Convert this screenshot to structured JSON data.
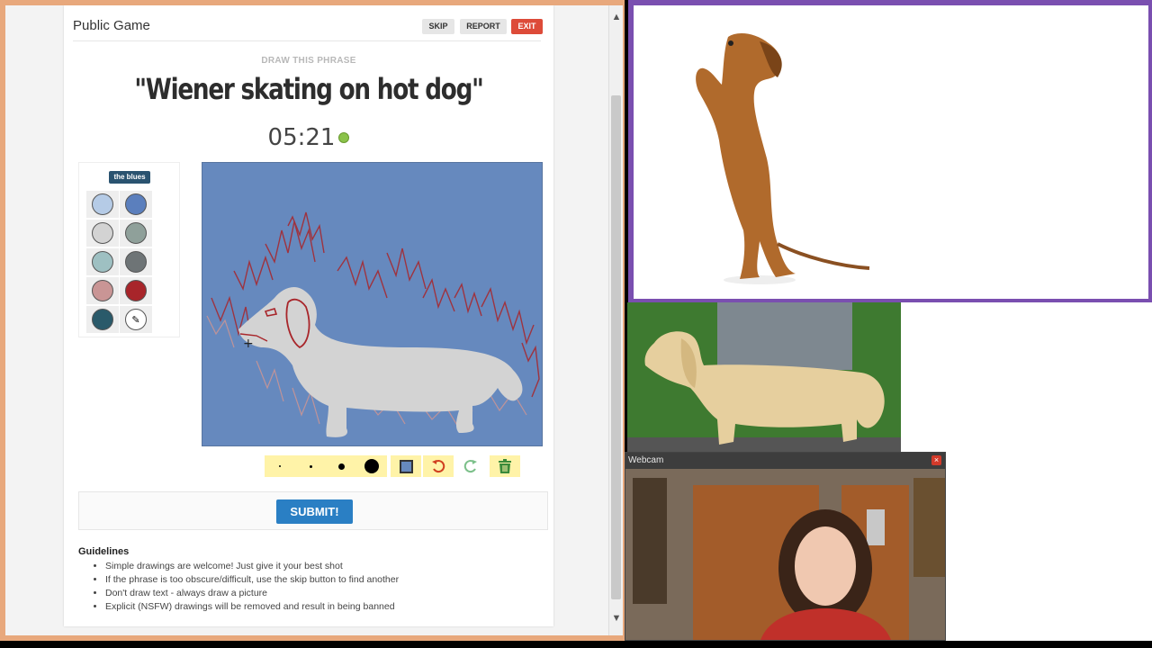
{
  "game": {
    "title": "Public Game",
    "buttons": {
      "skip": "SKIP",
      "report": "REPORT",
      "exit": "EXIT"
    },
    "instruction": "DRAW THIS PHRASE",
    "phrase": "\"Wiener skating on hot dog\"",
    "timer": "05:21"
  },
  "palette": {
    "name": "the blues",
    "colors": [
      "#b5cbe6",
      "#5b7fbd",
      "#d3d3d3",
      "#8fa09a",
      "#9ec0c2",
      "#6e7476",
      "#c99595",
      "#a8252a",
      "#2a5a6a",
      "#ffffff"
    ]
  },
  "canvas": {
    "background": "#6689be"
  },
  "toolbar": {
    "tools": [
      "brush-size-xs",
      "brush-size-s",
      "brush-size-m",
      "brush-size-l",
      "fill-tool",
      "undo",
      "redo",
      "trash"
    ]
  },
  "submit": {
    "label": "SUBMIT!"
  },
  "guidelines": {
    "title": "Guidelines",
    "items": [
      "Simple drawings are welcome! Just give it your best shot",
      "If the phrase is too obscure/difficult, use the skip button to find another",
      "Don't draw text - always draw a picture",
      "Explicit (NSFW) drawings will be removed and result in being banned"
    ]
  },
  "webcam": {
    "title": "Webcam"
  }
}
